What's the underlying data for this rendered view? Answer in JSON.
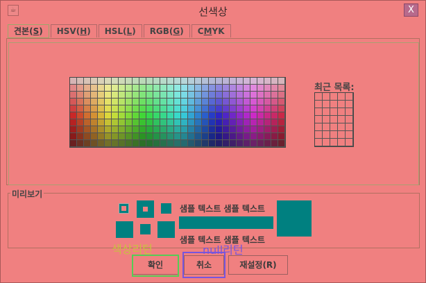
{
  "window": {
    "title": "선색상",
    "close_label": "X",
    "icon": "java-cup-icon"
  },
  "tabs": [
    {
      "label": "견본(S)",
      "text": "견본(",
      "mnemonic": "S",
      "tail": ")",
      "selected": true
    },
    {
      "label": "HSV(H)",
      "text": "HSV(",
      "mnemonic": "H",
      "tail": ")",
      "selected": false
    },
    {
      "label": "HSL(L)",
      "text": "HSL(",
      "mnemonic": "L",
      "tail": ")",
      "selected": false
    },
    {
      "label": "RGB(G)",
      "text": "RGB(",
      "mnemonic": "G",
      "tail": ")",
      "selected": false
    },
    {
      "label": "CMYK",
      "text": "C",
      "mnemonic": "M",
      "tail": "YK",
      "selected": false
    }
  ],
  "swatches": {
    "recent_label": "최근 목록:"
  },
  "preview": {
    "label": "미리보기",
    "sample_text": "샘플 텍스트  샘플 텍스트",
    "color": "#008080"
  },
  "buttons": {
    "ok": "확인",
    "cancel": "취소",
    "reset": "재설정(R)"
  },
  "annotations": {
    "ok_overlay": "색상리턴",
    "cancel_overlay": "null리턴",
    "ok_color": "#55cc55",
    "cancel_color": "#7755dd"
  }
}
